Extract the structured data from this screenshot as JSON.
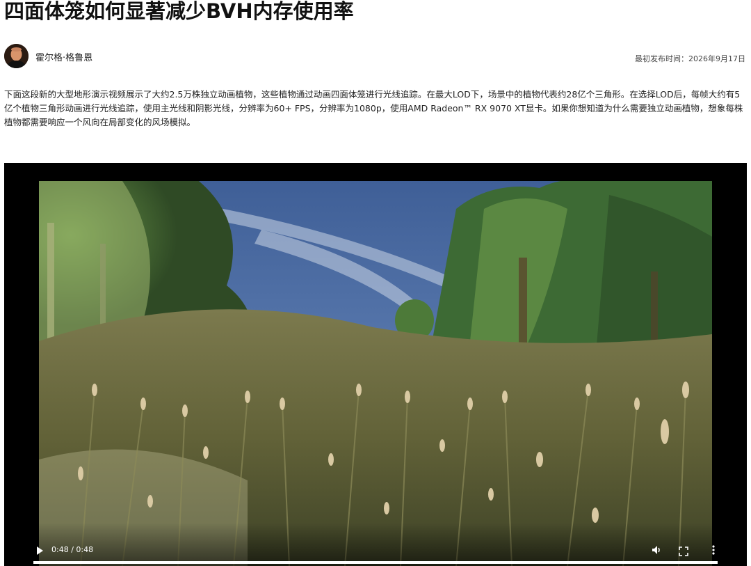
{
  "article": {
    "title": "四面体笼如何显著减少BVH内存使用率",
    "author": "霍尔格·格鲁恩",
    "published": "最初发布时间：2026年9月17日",
    "intro": "下面这段新的大型地形演示视频展示了大约2.5万株独立动画植物，这些植物通过动画四面体笼进行光线追踪。在最大LOD下，场景中的植物代表约28亿个三角形。在选择LOD后，每帧大约有5亿个植物三角形动画进行光线追踪，使用主光线和阴影光线，分辨率为60+ FPS，分辨率为1080p，使用AMD Radeon™ RX 9070 XT显卡。如果你想知道为什么需要独立动画植物，想象每株植物都需要响应一个风向在局部变化的风场模拟。"
  },
  "video": {
    "time_display": "0:48 / 0:48",
    "progress": 1.0,
    "icons": {
      "play": "play-icon",
      "volume": "volume-icon",
      "fullscreen": "fullscreen-icon",
      "more": "more-vert-icon"
    }
  }
}
